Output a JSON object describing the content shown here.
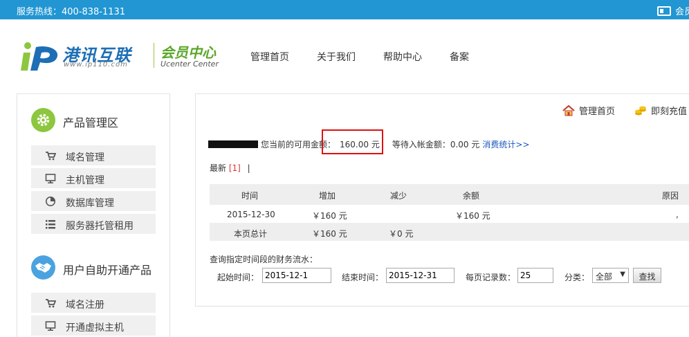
{
  "topbar": {
    "hotline": "服务热线：400-838-1131",
    "member_label": "会员"
  },
  "header": {
    "brand": "港讯互联",
    "brand_url": "www.ip110.com",
    "ucenter_cn": "会员中心",
    "ucenter_en": "Ucenter Center",
    "nav": [
      "管理首页",
      "关于我们",
      "帮助中心",
      "备案"
    ]
  },
  "sidebar": {
    "sections": [
      {
        "title": "产品管理区",
        "icon": "gear-icon",
        "items": [
          {
            "label": "域名管理",
            "icon": "cart-icon"
          },
          {
            "label": "主机管理",
            "icon": "monitor-icon"
          },
          {
            "label": "数据库管理",
            "icon": "pie-chart-icon"
          },
          {
            "label": "服务器托管租用",
            "icon": "list-icon"
          }
        ]
      },
      {
        "title": "用户自助开通产品",
        "icon": "handshake-icon",
        "items": [
          {
            "label": "域名注册",
            "icon": "cart-icon"
          },
          {
            "label": "开通虚拟主机",
            "icon": "monitor-icon"
          }
        ]
      }
    ]
  },
  "toolbar": {
    "home_label": "管理首页",
    "recharge_label": "即刻充值"
  },
  "balance": {
    "prefix": "您当前的可用金额：",
    "amount": "160.00 元",
    "pending_label": "等待入帐金额：",
    "pending_amount": "0.00 元",
    "stats_link": "消费统计>>"
  },
  "latest": {
    "label": "最新",
    "page": "[1]",
    "sep": "|"
  },
  "table": {
    "headers": [
      "时间",
      "增加",
      "减少",
      "余额",
      "原因"
    ],
    "rows": [
      [
        "2015-12-30",
        "￥160 元",
        "",
        "￥160 元",
        ","
      ],
      [
        "本页总计",
        "￥160 元",
        "￥0 元",
        "",
        ""
      ]
    ]
  },
  "query": {
    "title": "查询指定时间段的财务流水：",
    "start_label": "起始时间：",
    "start_value": "2015-12-1",
    "end_label": "结束时间：",
    "end_value": "2015-12-31",
    "per_page_label": "每页记录数：",
    "per_page_value": "25",
    "category_label": "分类：",
    "category_value": "全部",
    "search_button": "查找"
  },
  "colors": {
    "topbar": "#2196d3",
    "accent_green": "#8dc63f",
    "accent_blue": "#4aa3df",
    "highlight": "#dd1111",
    "link": "#1a55c0"
  }
}
